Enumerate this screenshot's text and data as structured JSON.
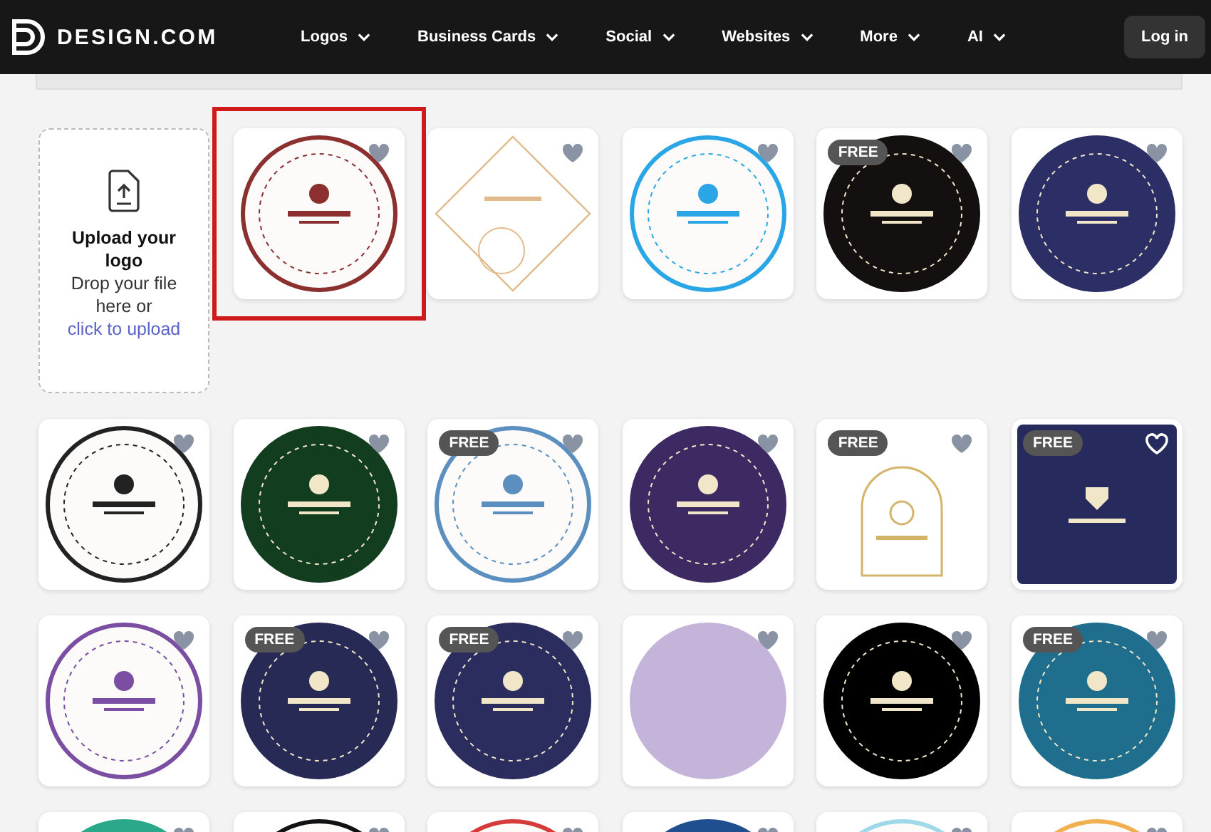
{
  "brand": {
    "name": "DESIGN.COM"
  },
  "nav": [
    {
      "label": "Logos"
    },
    {
      "label": "Business Cards"
    },
    {
      "label": "Social"
    },
    {
      "label": "Websites"
    },
    {
      "label": "More"
    },
    {
      "label": "AI"
    }
  ],
  "login": {
    "label": "Log in"
  },
  "upload": {
    "title": "Upload your logo",
    "text": "Drop your file here or",
    "link": "click to upload"
  },
  "templates": [
    {
      "kind": "ring",
      "color": "#8b2f2f",
      "selected": true,
      "hovered": false
    },
    {
      "kind": "diamond",
      "color": "#e2b98a",
      "selected": false,
      "hovered": false
    },
    {
      "kind": "ring",
      "color": "#2aa6e6",
      "selected": false,
      "hovered": false
    },
    {
      "kind": "circle",
      "color": "#141010",
      "badge": "FREE",
      "selected": false,
      "hovered": false
    },
    {
      "kind": "circle",
      "color": "#2c2f66",
      "selected": false,
      "hovered": false
    },
    {
      "kind": "ring",
      "color": "#222222",
      "selected": false,
      "hovered": false
    },
    {
      "kind": "circle",
      "color": "#123d1e",
      "selected": false,
      "hovered": false
    },
    {
      "kind": "ring",
      "color": "#5b8fbf",
      "badge": "FREE",
      "selected": false,
      "hovered": false
    },
    {
      "kind": "circle",
      "color": "#3e2a63",
      "selected": false,
      "hovered": false
    },
    {
      "kind": "arch",
      "color": "#d4b46a",
      "badge": "FREE",
      "selected": false,
      "hovered": false
    },
    {
      "kind": "square",
      "color": "#272a5c",
      "badge": "FREE",
      "selected": false,
      "hovered": true
    },
    {
      "kind": "ring",
      "color": "#7b4ea3",
      "selected": false,
      "hovered": false
    },
    {
      "kind": "circle",
      "color": "#262a55",
      "badge": "FREE",
      "selected": false,
      "hovered": false
    },
    {
      "kind": "circle",
      "color": "#2a2d5e",
      "badge": "FREE",
      "selected": false,
      "hovered": false
    },
    {
      "kind": "circle",
      "color": "#c5b4d9",
      "selected": false,
      "hovered": false
    },
    {
      "kind": "circle",
      "color": "#000000",
      "selected": false,
      "hovered": false
    },
    {
      "kind": "circle",
      "color": "#1f6e8e",
      "badge": "FREE",
      "selected": false,
      "hovered": false
    },
    {
      "kind": "circle",
      "color": "#2aa88a",
      "selected": false,
      "hovered": false
    },
    {
      "kind": "ring",
      "color": "#111111",
      "selected": false,
      "hovered": false
    },
    {
      "kind": "ring",
      "color": "#d63a3a",
      "selected": false,
      "hovered": false
    },
    {
      "kind": "circle",
      "color": "#1f4f8f",
      "selected": false,
      "hovered": false
    },
    {
      "kind": "ring",
      "color": "#9fd8e8",
      "selected": false,
      "hovered": false
    },
    {
      "kind": "ring",
      "color": "#f0b050",
      "selected": false,
      "hovered": false
    }
  ]
}
